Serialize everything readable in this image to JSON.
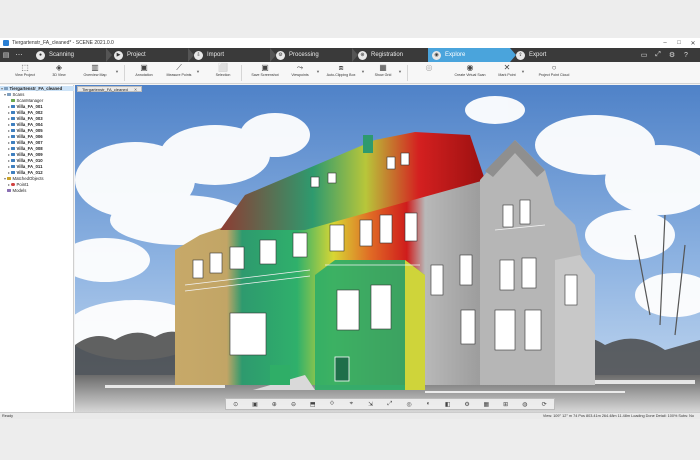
{
  "window": {
    "title": "Tiergartenstr_FA_cleaned* - SCENE 2021.0.0",
    "controls": [
      "–",
      "□",
      "✕"
    ]
  },
  "workflow": {
    "tabs": [
      {
        "label": "Scanning",
        "icon": "scanner-icon"
      },
      {
        "label": "Project",
        "icon": "project-icon"
      },
      {
        "label": "Import",
        "icon": "import-icon"
      },
      {
        "label": "Processing",
        "icon": "processing-icon"
      },
      {
        "label": "Registration",
        "icon": "registration-icon"
      },
      {
        "label": "Explore",
        "icon": "explore-icon"
      },
      {
        "label": "Export",
        "icon": "export-icon"
      }
    ],
    "active": "Explore"
  },
  "ribbon": {
    "items": [
      {
        "label": "View Project",
        "icon": "3d-cube-icon"
      },
      {
        "label": "3D View",
        "icon": "3d-view-icon"
      },
      {
        "label": "Overview Map",
        "icon": "map-icon"
      },
      {
        "label": "Annotation",
        "icon": "annotation-icon"
      },
      {
        "label": "Measure Points",
        "icon": "measure-icon"
      },
      {
        "label": "Selection",
        "icon": "selection-icon"
      },
      {
        "label": "Save Screenshot",
        "icon": "camera-icon"
      },
      {
        "label": "Viewpoints",
        "icon": "viewpoint-icon"
      },
      {
        "label": "Auto-Clipping Box",
        "icon": "clipping-box-icon"
      },
      {
        "label": "Show Grid",
        "icon": "grid-icon"
      },
      {
        "label": "Create Virtual Scan",
        "icon": "virtual-scan-icon"
      },
      {
        "label": "Mark Point",
        "icon": "mark-point-icon"
      },
      {
        "label": "Project Point Cloud",
        "icon": "point-cloud-icon"
      }
    ]
  },
  "tree": {
    "root": "Tiergartenstr_FA_cleaned",
    "scans": "Scans",
    "scan_manager": "ScanManager",
    "items": [
      "Villa_FA_001",
      "Villa_FA_002",
      "Villa_FA_003",
      "Villa_FA_004",
      "Villa_FA_005",
      "Villa_FA_006",
      "Villa_FA_007",
      "Villa_FA_008",
      "Villa_FA_009",
      "Villa_FA_010",
      "Villa_FA_011",
      "Villa_FA_012"
    ],
    "matched_objects": "MatchedObjects",
    "point": "Point1",
    "models": "Models"
  },
  "viewport": {
    "tab_label": "Tiergartenstr_FA_cleaned",
    "tab_close": "✕"
  },
  "viewport_tools": [
    "⊙",
    "▣",
    "⊕",
    "⊖",
    "⬒",
    "⟐",
    "⌖",
    "⇲",
    "⤢",
    "◎",
    "◐",
    "◧",
    "⚙",
    "▦",
    "⊞",
    "◍",
    "⟳"
  ],
  "status": {
    "left": "Ready",
    "right": "View: 109° 12° m  74 Pos  803.41m 264.48m 11.48m  Loading Done  Detail: 100%  Subs: No"
  },
  "colors": {
    "title_bar": "#ffffff",
    "workflow_bar": "#3a3a3a",
    "workflow_active": "#4aa4dc",
    "sky": "#7fa6d8"
  }
}
